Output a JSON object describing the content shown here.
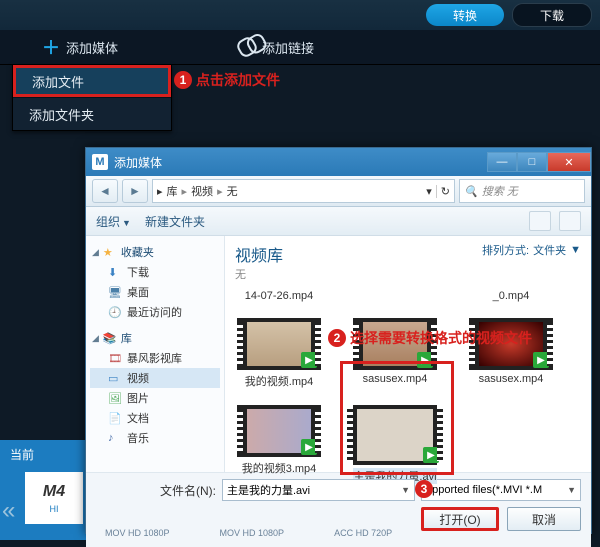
{
  "topbar": {
    "convert": "转换",
    "download": "下载"
  },
  "menubar": {
    "add_media": "添加媒体",
    "add_link": "添加链接"
  },
  "dropdown": {
    "add_file": "添加文件",
    "add_folder": "添加文件夹"
  },
  "annotations": {
    "n1": "1",
    "t1": "点击添加文件",
    "n2": "2",
    "t2": "选择需要转换格式的视频文件",
    "n3": "3"
  },
  "leftpanel": {
    "current": "当前",
    "m4": "M4",
    "res": "HI"
  },
  "chevron": "«",
  "dialog": {
    "title": "添加媒体",
    "win": {
      "min": "—",
      "max": "□",
      "close": "✕"
    },
    "nav": {
      "back": "◄",
      "fwd": "►",
      "crumbs": [
        "库",
        "视频",
        "无"
      ],
      "sep": "▸",
      "dd": "▾",
      "refresh": "↻",
      "search_ph": "搜索 无",
      "search_ico": "🔍"
    },
    "toolbar": {
      "organize": "组织",
      "newfolder": "新建文件夹",
      "dd": "▼"
    },
    "tree": {
      "fav": "收藏夹",
      "dl": "下载",
      "desk": "桌面",
      "recent": "最近访问的",
      "lib": "库",
      "bfun": "暴风影视库",
      "video": "视频",
      "pic": "图片",
      "doc": "文档",
      "music": "音乐",
      "tri_open": "◢",
      "tri_closed": "▷",
      "i_star": "★",
      "i_dl": "⬇",
      "i_desk": "🖥",
      "i_rec": "🕘",
      "i_lib": "📚",
      "i_film": "🎞",
      "i_vid": "▭",
      "i_pic": "🖼",
      "i_doc": "📄",
      "i_mus": "♪"
    },
    "files": {
      "lib_title": "视频库",
      "lib_sub": "无",
      "sort_lbl": "排列方式:",
      "sort_val": "文件夹",
      "sort_dd": "▼",
      "items": [
        {
          "name": "14-07-26.mp4"
        },
        {
          "name": "_0.mp4"
        },
        {
          "name": "我的视频.mp4"
        },
        {
          "name": "sasusex.mp4"
        },
        {
          "name": "sasusex.mp4"
        },
        {
          "name": "我的视频3.mp4"
        },
        {
          "name": "主是我的力量.avi"
        }
      ],
      "play": "▶"
    },
    "bottom": {
      "filename_lbl": "文件名(N):",
      "filename_val": "主是我的力量.avi",
      "filter": "upported files(*.MVI *.M",
      "open": "打开(O)",
      "cancel": "取消",
      "dd": "▼"
    }
  },
  "strip": {
    "a": "MOV HD 1080P",
    "b": "MOV HD 1080P",
    "c": "ACC HD 720P"
  }
}
